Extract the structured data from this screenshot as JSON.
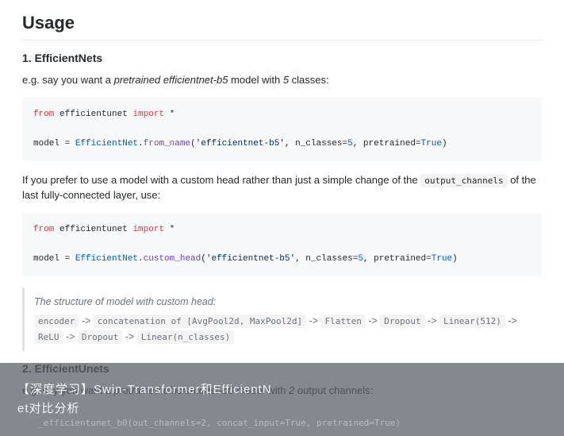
{
  "heading": "Usage",
  "section1": {
    "title": "1. EfficientNets",
    "intro_pre": "e.g. say you want a ",
    "intro_em": "pretrained efficientnet-b5",
    "intro_mid": " model with ",
    "intro_em2": "5",
    "intro_post": " classes:",
    "code1": {
      "kw_from": "from",
      "mod": " efficientunet ",
      "kw_import": "import",
      "star": " *",
      "lhs": "model = ",
      "cls": "EfficientNet",
      "dot": ".",
      "fn": "from_name",
      "open": "(",
      "arg_str": "'efficientnet-b5'",
      "args_mid": ", n_classes=",
      "val5": "5",
      "args_mid2": ", pretrained=",
      "valT": "True",
      "close": ")"
    },
    "para2_pre": "If you prefer to use a model with a custom head rather than just a simple change of the ",
    "para2_code": "output_channels",
    "para2_post": " of the last fully-connected layer, use:",
    "code2": {
      "fn": "custom_head"
    },
    "quote_head": "The structure of model with custom head:",
    "quote_body_parts": {
      "enc": "encoder",
      "arr": " -> ",
      "concat": "concatenation of [AvgPool2d, MaxPool2d]",
      "flat": "Flatten",
      "drop": "Dropout",
      "lin512": "Linear(512)",
      "relu": "ReLU",
      "linN": "Linear(n_classes)"
    }
  },
  "section2": {
    "title": "2. EfficientUnets",
    "intro_pre": "e.g. say you want a ",
    "intro_em": "pretrained efficientunet-b0",
    "intro_mid": " model with ",
    "intro_em2": "2",
    "intro_post": " output channels:",
    "ghost": "_efficientunet_b0(out_channels=2, concat_input=True, pretrained=True)"
  },
  "overlay": {
    "line1": "【深度学习】Swin-Transformer和EfficientN",
    "line2": "et对比分析"
  }
}
